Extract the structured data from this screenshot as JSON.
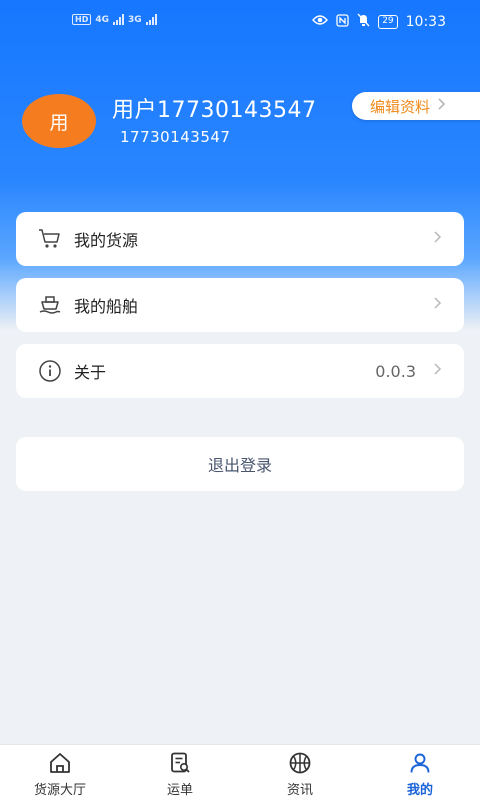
{
  "status_bar": {
    "hd_label": "HD",
    "sim1_label": "4G",
    "sim2_label": "3G",
    "battery": "29",
    "time": "10:33"
  },
  "profile": {
    "avatar_text": "用",
    "name": "用户17730143547",
    "phone": "17730143547",
    "edit_label": "编辑资料"
  },
  "menu": {
    "items": [
      {
        "label": "我的货源",
        "icon": "cart-icon",
        "value": ""
      },
      {
        "label": "我的船舶",
        "icon": "ship-icon",
        "value": ""
      },
      {
        "label": "关于",
        "icon": "info-icon",
        "value": "0.0.3"
      }
    ],
    "logout_label": "退出登录"
  },
  "tabbar": {
    "tabs": [
      {
        "label": "货源大厅",
        "icon": "home-icon",
        "active": false
      },
      {
        "label": "运单",
        "icon": "waybill-search-icon",
        "active": false
      },
      {
        "label": "资讯",
        "icon": "basketball-icon",
        "active": false
      },
      {
        "label": "我的",
        "icon": "user-icon",
        "active": true
      }
    ]
  },
  "colors": {
    "brand_blue": "#1677ff",
    "avatar_orange": "#f57c1f",
    "edit_orange": "#f08a1c",
    "active_tab": "#1a63d8"
  }
}
